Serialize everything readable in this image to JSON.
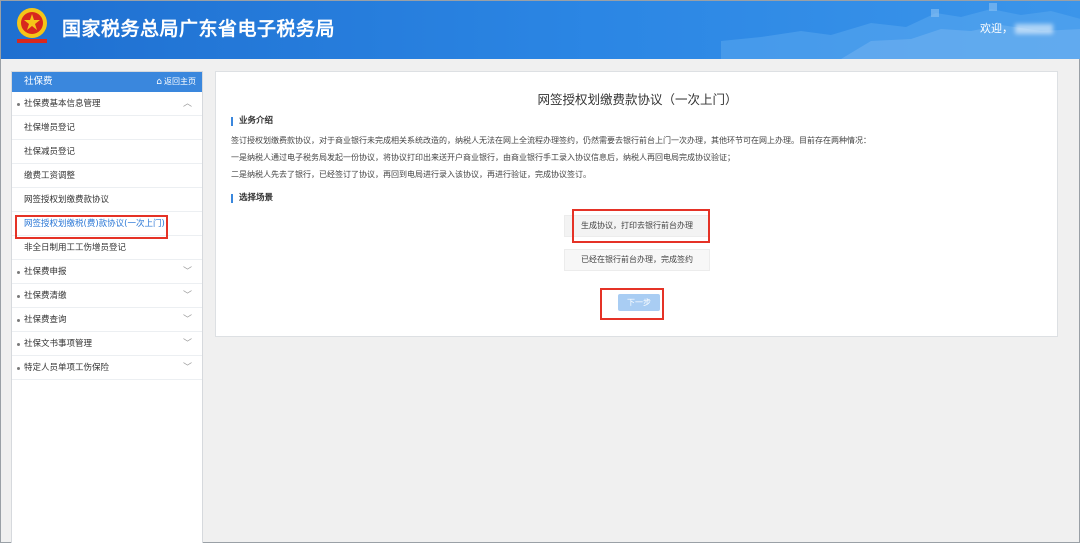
{
  "header": {
    "title": "国家税务总局广东省电子税务局",
    "welcome_label": "欢迎，",
    "emblem_caption": "中国税务"
  },
  "sidebar": {
    "title": "社保费",
    "home_link": "返回主页",
    "items": [
      {
        "label": "社保费基本信息管理",
        "type": "parent",
        "expanded": true
      },
      {
        "label": "社保增员登记",
        "type": "child"
      },
      {
        "label": "社保减员登记",
        "type": "child"
      },
      {
        "label": "缴费工资调整",
        "type": "child"
      },
      {
        "label": "网签授权划缴费款协议",
        "type": "child"
      },
      {
        "label": "网签授权划缴税(费)款协议(一次上门)",
        "type": "child",
        "active": true
      },
      {
        "label": "非全日制用工工伤增员登记",
        "type": "child"
      },
      {
        "label": "社保费申报",
        "type": "parent"
      },
      {
        "label": "社保费清缴",
        "type": "parent"
      },
      {
        "label": "社保费查询",
        "type": "parent"
      },
      {
        "label": "社保文书事项管理",
        "type": "parent"
      },
      {
        "label": "特定人员单项工伤保险",
        "type": "parent"
      }
    ]
  },
  "main": {
    "title": "网签授权划缴费款协议（一次上门）",
    "section_intro": "业务介绍",
    "intro_lines": [
      "签订授权划缴费款协议，对于商业银行未完成相关系统改造的，纳税人无法在网上全流程办理签约，仍然需要去银行前台上门一次办理，其他环节可在网上办理。目前存在两种情况：",
      "一是纳税人通过电子税务局发起一份协议，将协议打印出来送开户商业银行，由商业银行手工录入协议信息后，纳税人再回电局完成协议验证；",
      "二是纳税人先去了银行，已经签订了协议，再回到电局进行录入该协议，再进行验证，完成协议签订。"
    ],
    "section_scene": "选择场景",
    "option_1": "生成协议，打印去银行前台办理",
    "option_2": "已经在银行前台办理，完成签约",
    "next_button": "下一步"
  },
  "colors": {
    "header_blue": "#2b86e4",
    "sidebar_head": "#3a87dd",
    "highlight_red": "#e53226",
    "active_link": "#2a77d6",
    "next_button_bg": "#a9cdf3"
  }
}
